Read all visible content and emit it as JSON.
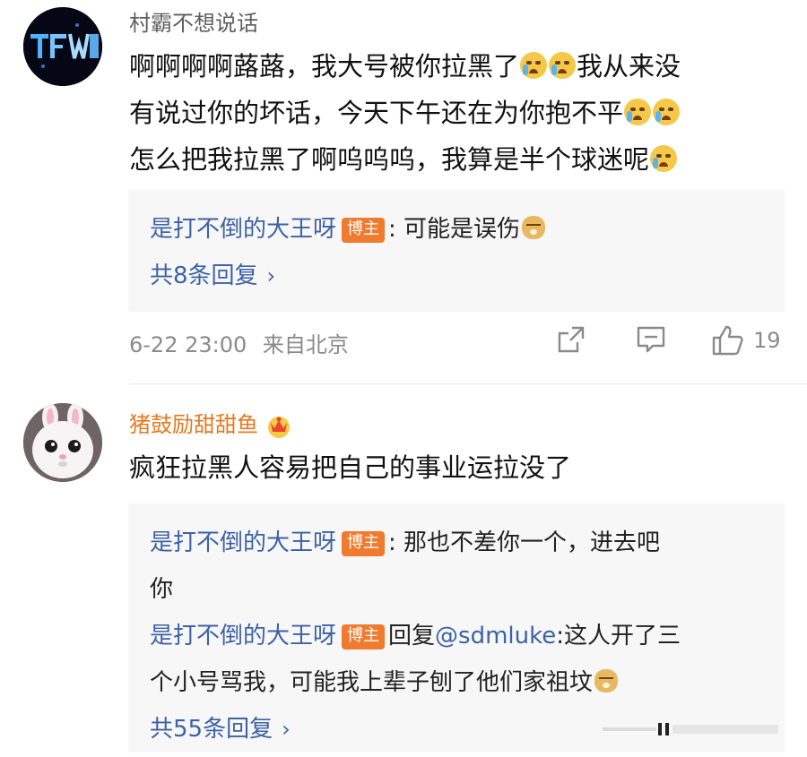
{
  "comments": [
    {
      "username": "村霸不想说话",
      "avatar_icon": "avatar-neon-sign",
      "text_parts": [
        "啊啊啊啊蕗蕗，我大号被你拉黑了",
        "我从来没",
        "有说过你的坏话，今天下午还在为你抱不平",
        "怎么把我拉黑了啊呜呜呜，我算是半个球迷呢"
      ],
      "replies": [
        {
          "user": "是打不倒的大王呀",
          "badge": "博主",
          "text": ": 可能是误伤"
        }
      ],
      "more_replies": "共8条回复",
      "timestamp": "6-22 23:00",
      "location": "来自北京",
      "like_count": "19"
    },
    {
      "username": "猪鼓励甜甜鱼",
      "avatar_icon": "avatar-white-rabbit",
      "member_icon": "crown-badge-icon",
      "text": "疯狂拉黑人容易把自己的事业运拉没了",
      "replies": [
        {
          "user": "是打不倒的大王呀",
          "badge": "博主",
          "text_line1": ": 那也不差你一个，进去吧",
          "text_line2": "你"
        },
        {
          "user": "是打不倒的大王呀",
          "badge": "博主",
          "prefix": "回复",
          "mention": "@sdmluke",
          "text_line1": ":这人开了三",
          "text_line2": "个小号骂我，可能我上辈子刨了他们家祖坟"
        }
      ],
      "more_replies": "共55条回复"
    }
  ],
  "icons": {
    "share": "share-icon",
    "comment": "comment-icon",
    "like": "thumbs-up-icon",
    "chevron": "chevron-right-icon",
    "crying_emoji": "crying-emoji-icon",
    "doge_emoji": "doge-emoji-icon"
  },
  "colors": {
    "username_gray": "#5f5f5f",
    "username_vip": "#e57a1f",
    "link_blue": "#3d62a6",
    "badge_orange": "#f07a2e",
    "reply_bg": "#f7f7f7"
  }
}
